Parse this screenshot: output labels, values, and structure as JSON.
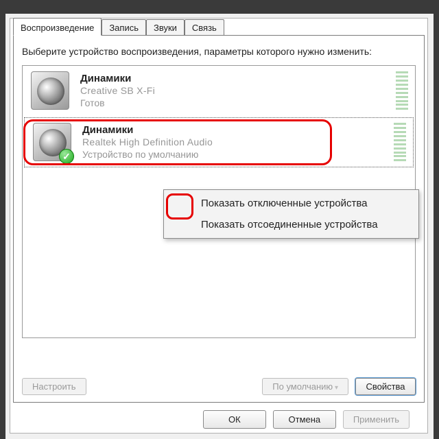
{
  "tabs": {
    "playback": "Воспроизведение",
    "recording": "Запись",
    "sounds": "Звуки",
    "comm": "Связь"
  },
  "instruction": "Выберите устройство воспроизведения, параметры которого нужно изменить:",
  "devices": [
    {
      "title": "Динамики",
      "subtitle": "Creative SB X-Fi",
      "status": "Готов",
      "default": false
    },
    {
      "title": "Динамики",
      "subtitle": "Realtek High Definition Audio",
      "status": "Устройство по умолчанию",
      "default": true
    }
  ],
  "context_menu": {
    "show_disabled": "Показать отключенные устройства",
    "show_disconnected": "Показать отсоединенные устройства"
  },
  "tab_buttons": {
    "configure": "Настроить",
    "set_default": "По умолчанию",
    "properties": "Свойства"
  },
  "dialog_buttons": {
    "ok": "ОК",
    "cancel": "Отмена",
    "apply": "Применить"
  }
}
